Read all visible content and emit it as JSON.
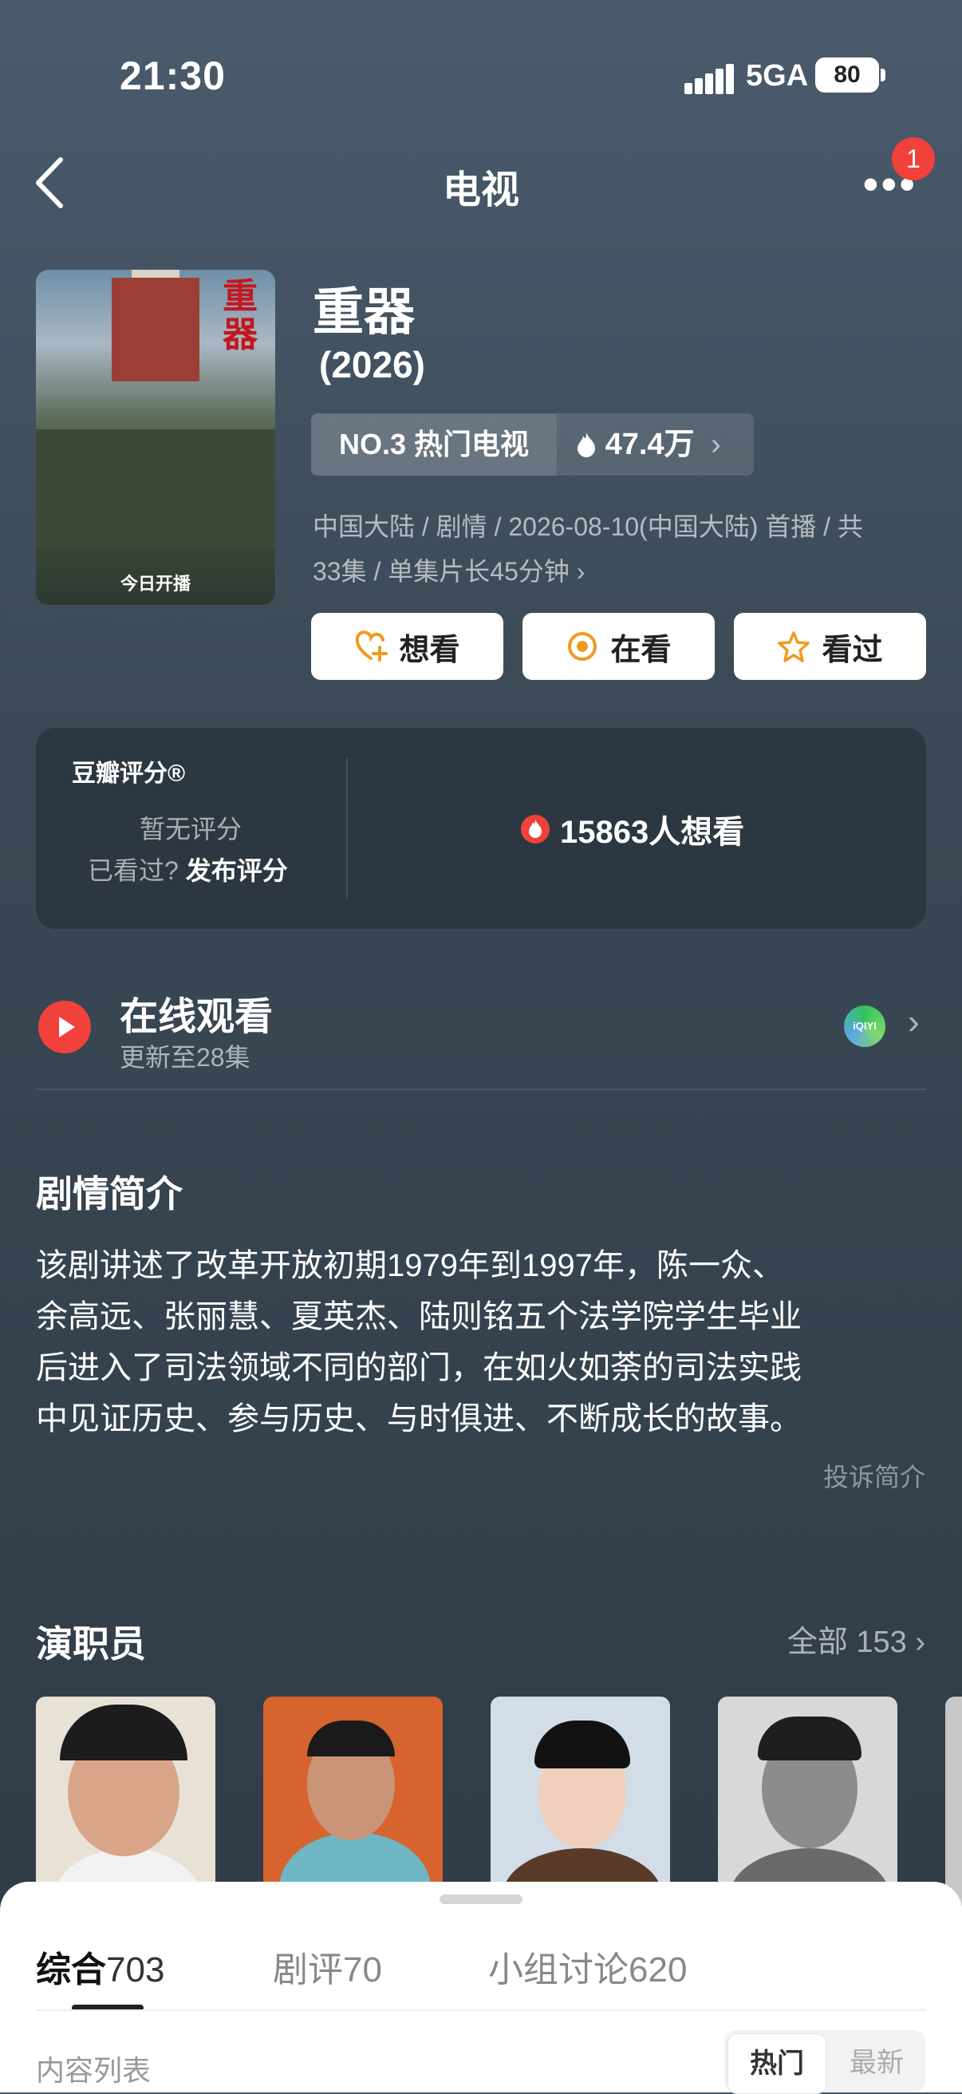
{
  "status_bar": {
    "time": "21:30",
    "network": "5GA",
    "battery": "80"
  },
  "nav": {
    "title": "电视",
    "notification_count": "1"
  },
  "movie": {
    "poster_title": "重器",
    "poster_caption": "今日开播",
    "title": "重器",
    "year": "(2026)",
    "rank": "NO.3 热门电视",
    "heat": "47.4万",
    "meta_line1": "中国大陆 / 剧情 / 2026-08-10(中国大陆) 首播 / 共",
    "meta_line2": "33集 / 单集片长45分钟"
  },
  "actions": {
    "want": "想看",
    "watching": "在看",
    "watched": "看过"
  },
  "rating": {
    "label": "豆瓣评分®",
    "no_score": "暂无评分",
    "seen_prefix": "已看过?",
    "publish": "发布评分",
    "wants": "15863人想看"
  },
  "online": {
    "title": "在线观看",
    "update": "更新至28集",
    "provider": "iQIYI"
  },
  "synopsis": {
    "title": "剧情简介",
    "lines": [
      "该剧讲述了改革开放初期1979年到1997年，陈一众、",
      "余高远、张丽慧、夏英杰、陆则铭五个法学院学生毕业",
      "后进入了司法领域不同的部门，在如火如荼的司法实践",
      "中见证历史、参与历史、与时俱进、不断成长的故事。"
    ],
    "report": "投诉简介"
  },
  "cast": {
    "title": "演职员",
    "all": "全部 153"
  },
  "sheet": {
    "tabs": [
      {
        "label": "综合",
        "count": "703"
      },
      {
        "label": "剧评",
        "count": "70"
      },
      {
        "label": "小组讨论",
        "count": "620"
      }
    ],
    "list_label": "内容列表",
    "sort_hot": "热门",
    "sort_new": "最新"
  },
  "colors": {
    "accent_red": "#f0423a",
    "star_orange": "#f29a1f",
    "bg": "#3b4956"
  }
}
